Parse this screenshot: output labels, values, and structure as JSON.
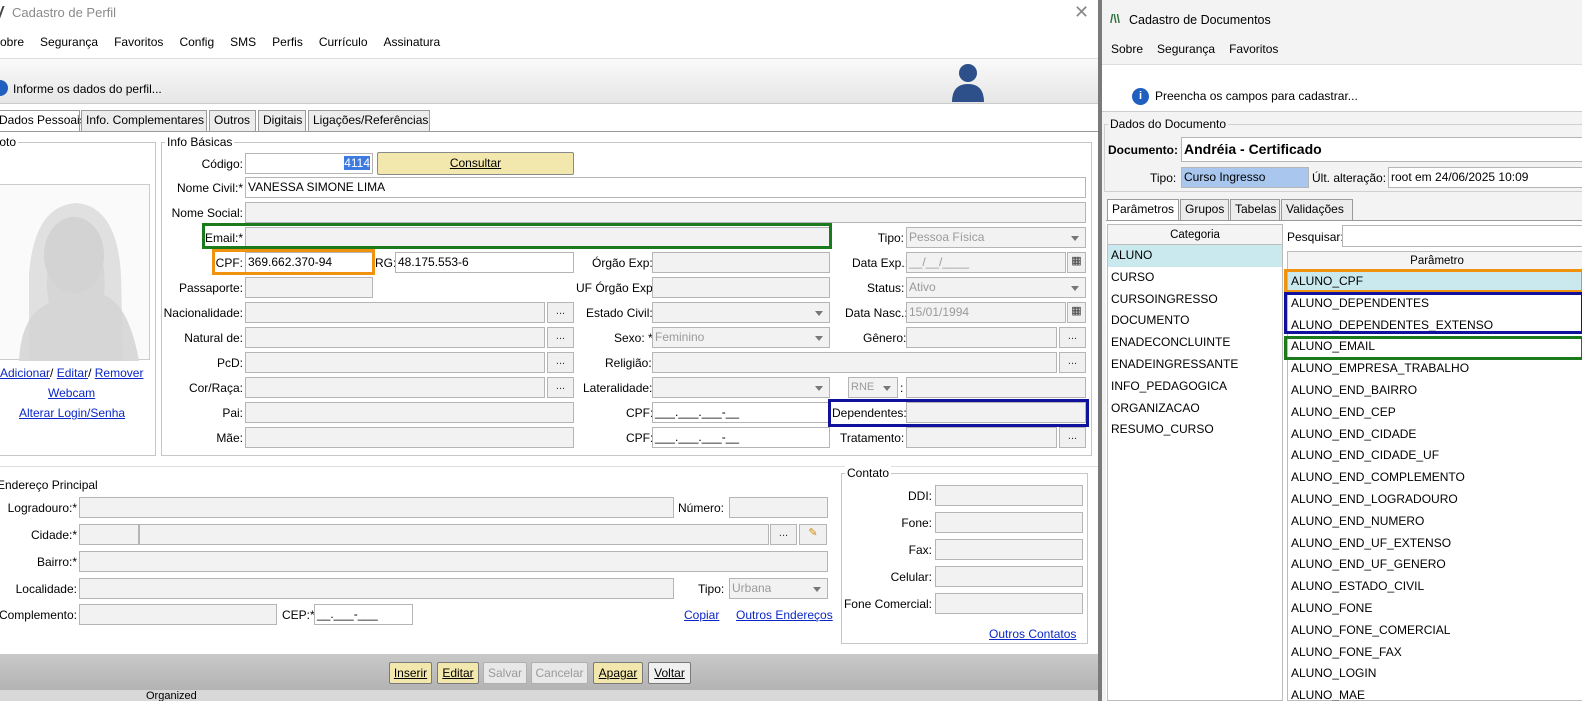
{
  "colors": {
    "orange": "#f0920e",
    "green": "#1b7a1b",
    "blue": "#10129e",
    "button": "#f2e7ac"
  },
  "left": {
    "title": "Cadastro de Perfil",
    "menu": [
      "Sobre",
      "Segurança",
      "Favoritos",
      "Config",
      "SMS",
      "Perfis",
      "Currículo",
      "Assinatura"
    ],
    "info": "Informe os dados do perfil...",
    "tabs": [
      "Dados Pessoais",
      "Info. Complementares",
      "Outros",
      "Digitais",
      "Ligações/Referências"
    ],
    "photo": {
      "title": "Foto",
      "adicionar": "Adicionar",
      "editar": "Editar",
      "remover": "Remover",
      "sep": "/",
      "webcam": "Webcam",
      "alterar": "Alterar Login/Senha"
    },
    "basic": {
      "title": "Info Básicas",
      "codigo_label": "Código:",
      "codigo": "4114",
      "consultar": "Consultar",
      "nome_civil_label": "Nome Civil:*",
      "nome_civil": "VANESSA SIMONE LIMA",
      "nome_social_label": "Nome Social:",
      "email_label": "Email:*",
      "tipo_label": "Tipo:",
      "tipo": "Pessoa Física",
      "cpf_label": "CPF:",
      "cpf": "369.662.370-94",
      "rg_label": "RG:",
      "rg": "48.175.553-6",
      "orgao_label": "Órgão Exp:",
      "data_exp_label": "Data Exp.:",
      "data_exp": "__/__/____",
      "passaporte_label": "Passaporte:",
      "uf_orgao_label": "UF Órgão Exp:",
      "status_label": "Status:",
      "status": "Ativo",
      "nacionalidade_label": "Nacionalidade:",
      "estado_civil_label": "Estado Civil:",
      "data_nasc_label": "Data Nasc.:",
      "data_nasc": "15/01/1994",
      "natural_label": "Natural de:",
      "sexo_label": "Sexo: *",
      "sexo": "Feminino",
      "genero_label": "Gênero:",
      "pcd_label": "PcD:",
      "religiao_label": "Religião:",
      "cor_label": "Cor/Raça:",
      "lateralidade_label": "Lateralidade:",
      "rne": "RNE",
      "colon": ":",
      "pai_label": "Pai:",
      "cpf2_label": "CPF:",
      "cpf_mask": "___.___.___-__",
      "dependentes_label": "Dependentes:",
      "mae_label": "Mãe:",
      "tratamento_label": "Tratamento:",
      "dots": "..."
    },
    "address": {
      "title": "Endereço Principal",
      "logradouro_label": "Logradouro:*",
      "numero_label": "Número:",
      "cidade_label": "Cidade:*",
      "bairro_label": "Bairro:*",
      "localidade_label": "Localidade:",
      "tipo_label": "Tipo:",
      "tipo": "Urbana",
      "complemento_label": "Complemento:",
      "cep_label": "CEP:*",
      "cep": "__.___-___",
      "copiar": "Copiar",
      "outros": "Outros Endereços"
    },
    "contact": {
      "title": "Contato",
      "ddi": "DDI:",
      "fone": "Fone:",
      "fax": "Fax:",
      "celular": "Celular:",
      "comercial": "Fone Comercial:",
      "outros": "Outros Contatos"
    },
    "footer": {
      "inserir": "Inserir",
      "editar": "Editar",
      "salvar": "Salvar",
      "cancelar": "Cancelar",
      "apagar": "Apagar",
      "voltar": "Voltar",
      "bottom": "Organized"
    }
  },
  "right": {
    "title": "Cadastro de Documentos",
    "menu": [
      "Sobre",
      "Segurança",
      "Favoritos"
    ],
    "info": "Preencha os campos para cadastrar...",
    "group": "Dados do Documento",
    "documento_label": "Documento:",
    "documento": "Andréia - Certificado",
    "tipo_label": "Tipo:",
    "tipo": "Curso Ingresso",
    "ult_label": "Últ. alteração:",
    "ult": "root em 24/06/2025 10:09",
    "tabs": [
      "Parâmetros",
      "Grupos",
      "Tabelas",
      "Validações"
    ],
    "categoria_header": "Categoria",
    "categorias": [
      "ALUNO",
      "CURSO",
      "CURSOINGRESSO",
      "DOCUMENTO",
      "ENADECONCLUINTE",
      "ENADEINGRESSANTE",
      "INFO_PEDAGOGICA",
      "ORGANIZACAO",
      "RESUMO_CURSO"
    ],
    "pesquisar_label": "Pesquisar:",
    "parametro_header": "Parâmetro",
    "parametros": [
      "ALUNO_CPF",
      "ALUNO_DEPENDENTES",
      "ALUNO_DEPENDENTES_EXTENSO",
      "ALUNO_EMAIL",
      "ALUNO_EMPRESA_TRABALHO",
      "ALUNO_END_BAIRRO",
      "ALUNO_END_CEP",
      "ALUNO_END_CIDADE",
      "ALUNO_END_CIDADE_UF",
      "ALUNO_END_COMPLEMENTO",
      "ALUNO_END_LOGRADOURO",
      "ALUNO_END_NUMERO",
      "ALUNO_END_UF_EXTENSO",
      "ALUNO_END_UF_GENERO",
      "ALUNO_ESTADO_CIVIL",
      "ALUNO_FONE",
      "ALUNO_FONE_COMERCIAL",
      "ALUNO_FONE_FAX",
      "ALUNO_LOGIN",
      "ALUNO_MAE"
    ]
  }
}
